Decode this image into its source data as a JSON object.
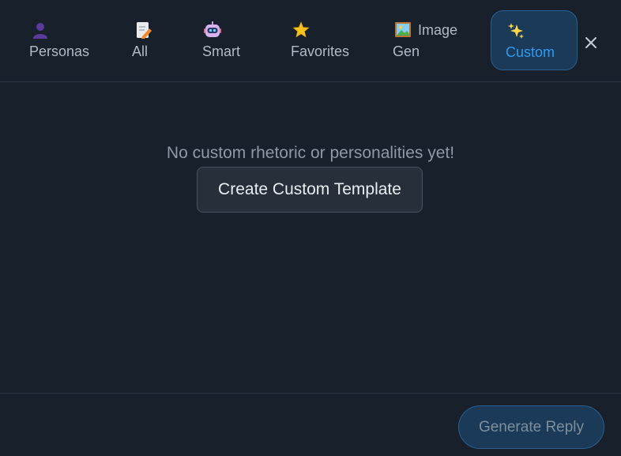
{
  "tabs": [
    {
      "label": "Personas",
      "icon": "person-silhouette-icon"
    },
    {
      "label": "All",
      "icon": "memo-pencil-icon"
    },
    {
      "label": "Smart",
      "icon": "robot-icon"
    },
    {
      "label": "Favorites",
      "icon": "star-icon"
    },
    {
      "label": "Image",
      "label2": "Gen",
      "icon": "framed-picture-icon"
    },
    {
      "label": "Custom",
      "icon": "sparkles-icon",
      "active": true
    }
  ],
  "close": {
    "icon": "close-icon"
  },
  "empty_state": {
    "message": "No custom rhetoric or personalities yet!",
    "button_label": "Create Custom Template"
  },
  "footer": {
    "generate_label": "Generate Reply"
  },
  "colors": {
    "background": "#17202b",
    "accent": "#2f9bf0",
    "active_tab_bg": "#1a3a57",
    "text_muted": "#8e99a6"
  }
}
